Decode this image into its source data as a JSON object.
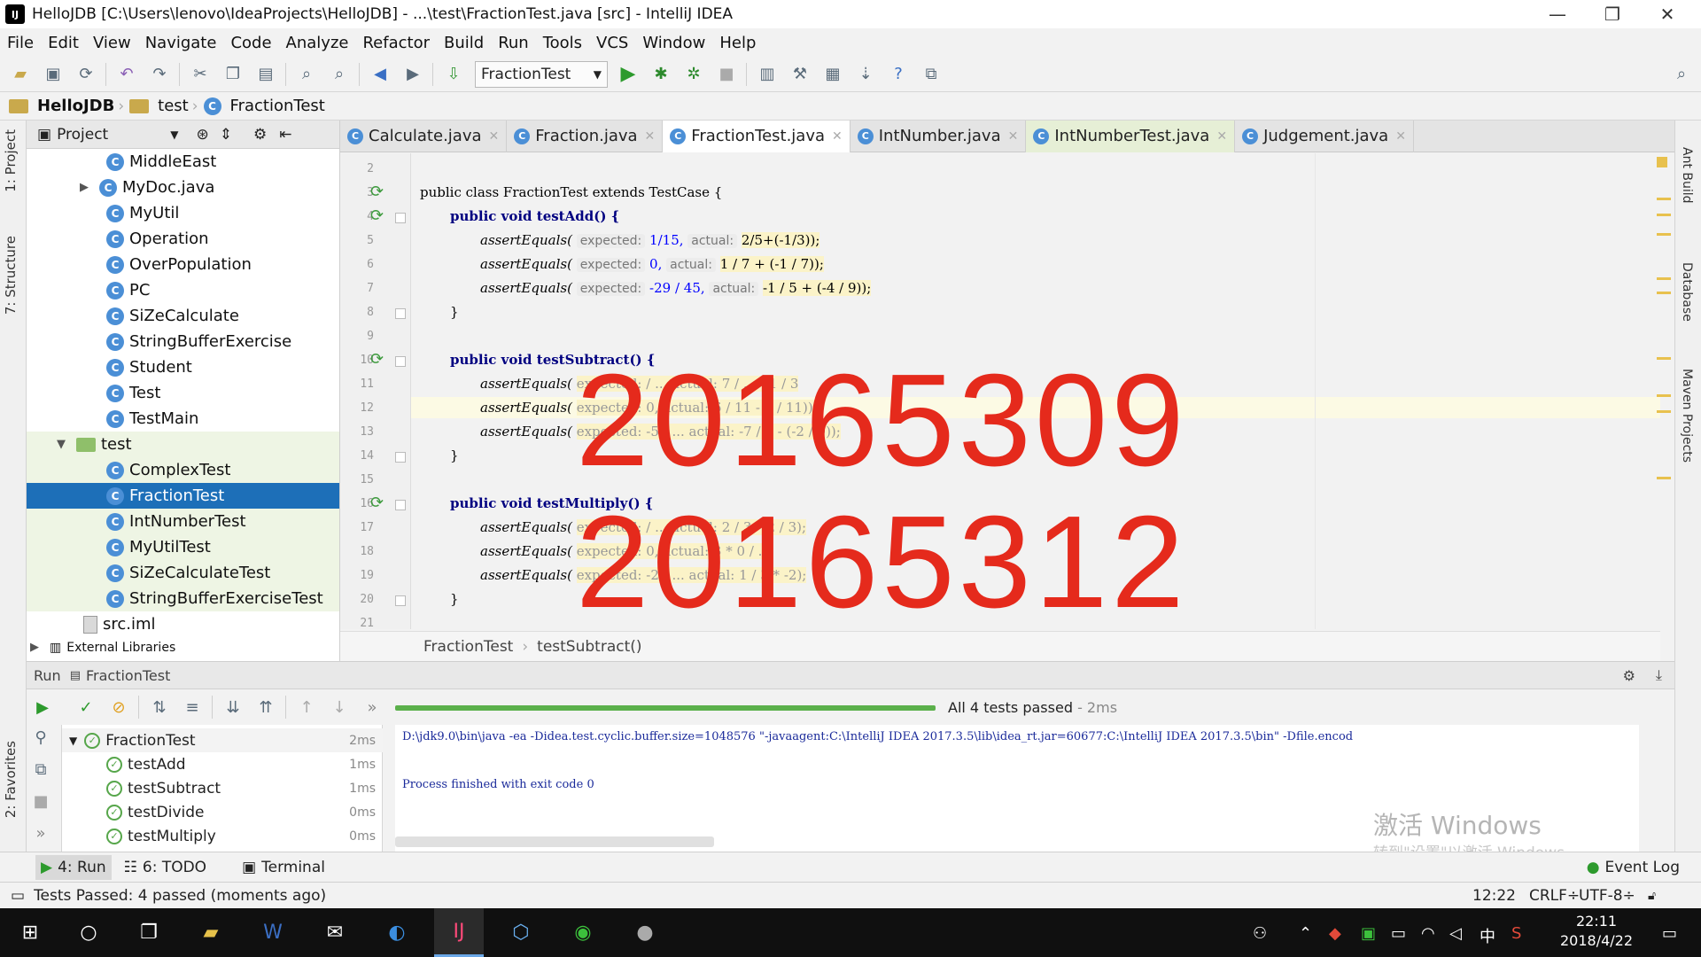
{
  "window": {
    "title": "HelloJDB [C:\\Users\\lenovo\\IdeaProjects\\HelloJDB] - ...\\test\\FractionTest.java [src] - IntelliJ IDEA",
    "minimize": "—",
    "maximize": "❐",
    "close": "✕"
  },
  "menu": [
    "File",
    "Edit",
    "View",
    "Navigate",
    "Code",
    "Analyze",
    "Refactor",
    "Build",
    "Run",
    "Tools",
    "VCS",
    "Window",
    "Help"
  ],
  "toolbar": {
    "run_config": "FractionTest"
  },
  "breadcrumb": [
    "HelloJDB",
    "test",
    "FractionTest"
  ],
  "left_tabs": {
    "project": "1: Project",
    "structure": "7: Structure",
    "favorites": "2: Favorites"
  },
  "right_tabs": {
    "ant": "Ant Build",
    "database": "Database",
    "maven": "Maven Projects"
  },
  "project_panel": {
    "title": "Project",
    "items": [
      {
        "label": "MiddleEast",
        "kind": "class"
      },
      {
        "label": "MyDoc.java",
        "kind": "class"
      },
      {
        "label": "MyUtil",
        "kind": "class"
      },
      {
        "label": "Operation",
        "kind": "class"
      },
      {
        "label": "OverPopulation",
        "kind": "class"
      },
      {
        "label": "PC",
        "kind": "class"
      },
      {
        "label": "SiZeCalculate",
        "kind": "class"
      },
      {
        "label": "StringBufferExercise",
        "kind": "class"
      },
      {
        "label": "Student",
        "kind": "class"
      },
      {
        "label": "Test",
        "kind": "class"
      },
      {
        "label": "TestMain",
        "kind": "class"
      },
      {
        "label": "test",
        "kind": "folder"
      },
      {
        "label": "ComplexTest",
        "kind": "class"
      },
      {
        "label": "FractionTest",
        "kind": "class"
      },
      {
        "label": "IntNumberTest",
        "kind": "class"
      },
      {
        "label": "MyUtilTest",
        "kind": "class"
      },
      {
        "label": "SiZeCalculateTest",
        "kind": "class"
      },
      {
        "label": "StringBufferExerciseTest",
        "kind": "class"
      },
      {
        "label": "src.iml",
        "kind": "file"
      },
      {
        "label": "External Libraries",
        "kind": "lib"
      }
    ]
  },
  "editor_tabs": [
    "Calculate.java",
    "Fraction.java",
    "FractionTest.java",
    "IntNumber.java",
    "IntNumberTest.java",
    "Judgement.java"
  ],
  "code": {
    "line_numbers": [
      "2",
      "3",
      "4",
      "5",
      "6",
      "7",
      "8",
      "9",
      "10",
      "11",
      "12",
      "13",
      "14",
      "15",
      "16",
      "17",
      "18",
      "19",
      "20",
      "21"
    ],
    "class_decl": "public class FractionTest extends TestCase {",
    "test_add": "public void testAdd() {",
    "test_subtract": "public void testSubtract() {",
    "test_multiply": "public void testMultiply() {",
    "assert": "assertEquals(",
    "expected": "expected:",
    "actual": "actual:",
    "close_brace": "}",
    "l5_exp": "1/15,",
    "l5_act": "2/5+(-1/3));",
    "l6_exp": "0,",
    "l6_act": "1 / 7 + (-1 / 7));",
    "l7_exp": "-29 / 45,",
    "l7_act": "-1 / 5 + (-4 / 9));",
    "l11": "expected: / ... actual: 7 / ... - 1 / 3",
    "l12": "expected: 0, actual: 6 / 11 - 6 / 11));",
    "l13": "expected: -5 / ... actual: -7 / 9 - (-2 / 9));",
    "l17": "expected: / ... actual: 2 / 3 * 2 / 3);",
    "l18": "expected: 0, actual: 3 * 0 / ...",
    "l19": "expected: -2 / ... actual: 1 / 3 * -2);"
  },
  "watermark_numbers": [
    "20165309",
    "20165312"
  ],
  "editor_breadcrumb": [
    "FractionTest",
    "testSubtract()"
  ],
  "run_panel": {
    "title": "Run",
    "config": "FractionTest",
    "status": "All 4 tests passed",
    "duration": "- 2ms",
    "tree": [
      {
        "label": "FractionTest",
        "time": "2ms"
      },
      {
        "label": "testAdd",
        "time": "1ms"
      },
      {
        "label": "testSubtract",
        "time": "1ms"
      },
      {
        "label": "testDivide",
        "time": "0ms"
      },
      {
        "label": "testMultiply",
        "time": "0ms"
      }
    ],
    "console": [
      "D:\\jdk9.0\\bin\\java -ea -Didea.test.cyclic.buffer.size=1048576 \"-javaagent:C:\\IntelliJ IDEA 2017.3.5\\lib\\idea_rt.jar=60677:C:\\IntelliJ IDEA 2017.3.5\\bin\" -Dfile.encod",
      "Process finished with exit code 0"
    ]
  },
  "tool_windows": [
    "4: Run",
    "6: TODO",
    "Terminal",
    "Event Log"
  ],
  "status": {
    "message": "Tests Passed: 4 passed (moments ago)",
    "position": "12:22",
    "line_sep": "CRLF÷",
    "encoding": "UTF-8÷"
  },
  "os_watermark": {
    "line1": "激活 Windows",
    "line2": "转到\"设置\"以激活 Windows。"
  },
  "taskbar": {
    "time": "22:11",
    "date": "2018/4/22",
    "ime": "中"
  }
}
